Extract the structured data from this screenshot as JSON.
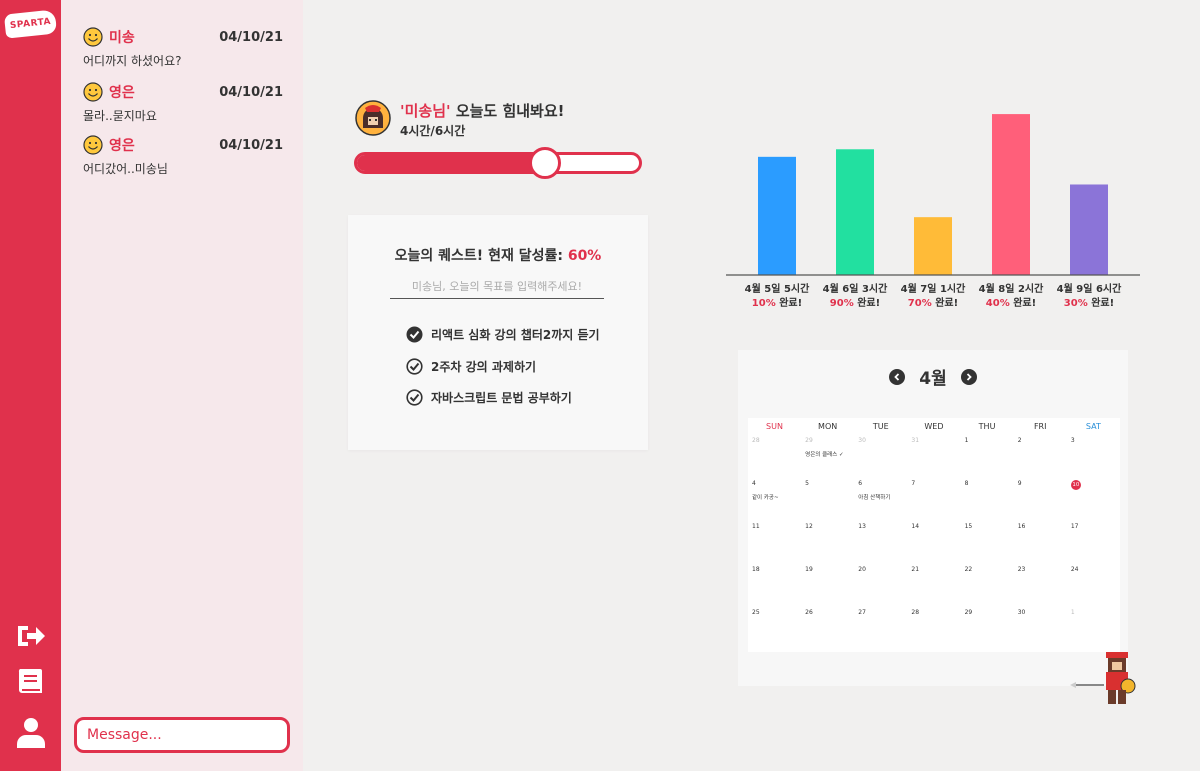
{
  "brand": {
    "logo_text": "SPARTA"
  },
  "rail": {
    "icons": [
      "logout-icon",
      "book-icon",
      "user-icon"
    ]
  },
  "chat": {
    "messages": [
      {
        "name": "미송",
        "date": "04/10/21",
        "text": "어디까지 하셨어요?"
      },
      {
        "name": "영은",
        "date": "04/10/21",
        "text": "몰라..묻지마요"
      },
      {
        "name": "영은",
        "date": "04/10/21",
        "text": "어디갔어..미송님"
      }
    ],
    "input_placeholder": "Message..."
  },
  "greeting": {
    "name": "'미송님'",
    "text": " 오늘도 힘내봐요!",
    "hours": "4시간/6시간",
    "progress": 0.6667
  },
  "quest": {
    "title": "오늘의 퀘스트! 현재 달성률: ",
    "percent": "60%",
    "goal_placeholder": "미송님, 오늘의 목표를 입력해주세요!",
    "todos": [
      "리액트 심화 강의 챕터2까지 듣기",
      "2주차 강의 과제하기",
      "자바스크립트 문법 공부하기"
    ]
  },
  "chart_data": {
    "type": "bar",
    "categories": [
      "4월 5일 5시간",
      "4월 6일 3시간",
      "4월 7일 1시간",
      "4월 8일 2시간",
      "4월 9일 6시간"
    ],
    "values": [
      4.7,
      5.0,
      2.3,
      6.4,
      3.6
    ],
    "completion_labels": [
      "10% 완료!",
      "90% 완료!",
      "70% 완료!",
      "40% 완료!",
      "30% 완료!"
    ],
    "colors": [
      "#2b9cff",
      "#22e0a0",
      "#ffbb38",
      "#ff5f7a",
      "#8b74d8"
    ],
    "ylim": [
      0,
      7
    ],
    "xlabel": "",
    "ylabel": ""
  },
  "calendar": {
    "month": "4월",
    "weekdays": [
      "SUN",
      "MON",
      "TUE",
      "WED",
      "THU",
      "FRI",
      "SAT"
    ],
    "weeks": [
      [
        {
          "d": "28",
          "dim": true
        },
        {
          "d": "29",
          "dim": true,
          "ev": "영은의 클래스 ✓"
        },
        {
          "d": "30",
          "dim": true
        },
        {
          "d": "31",
          "dim": true
        },
        {
          "d": "1"
        },
        {
          "d": "2"
        },
        {
          "d": "3"
        }
      ],
      [
        {
          "d": "4",
          "ev": "같이 카공~"
        },
        {
          "d": "5"
        },
        {
          "d": "6",
          "ev": "아침 산책하기"
        },
        {
          "d": "7"
        },
        {
          "d": "8"
        },
        {
          "d": "9"
        },
        {
          "d": "10",
          "today": true
        }
      ],
      [
        {
          "d": "11"
        },
        {
          "d": "12"
        },
        {
          "d": "13"
        },
        {
          "d": "14"
        },
        {
          "d": "15"
        },
        {
          "d": "16"
        },
        {
          "d": "17"
        }
      ],
      [
        {
          "d": "18"
        },
        {
          "d": "19"
        },
        {
          "d": "20"
        },
        {
          "d": "21"
        },
        {
          "d": "22"
        },
        {
          "d": "23"
        },
        {
          "d": "24"
        }
      ],
      [
        {
          "d": "25"
        },
        {
          "d": "26"
        },
        {
          "d": "27"
        },
        {
          "d": "28"
        },
        {
          "d": "29"
        },
        {
          "d": "30"
        },
        {
          "d": "1",
          "dim": true
        }
      ]
    ]
  },
  "colors": {
    "accent": "#e0314c",
    "chat_bg": "#f6e8eb",
    "page_bg": "#f1f0ef"
  }
}
